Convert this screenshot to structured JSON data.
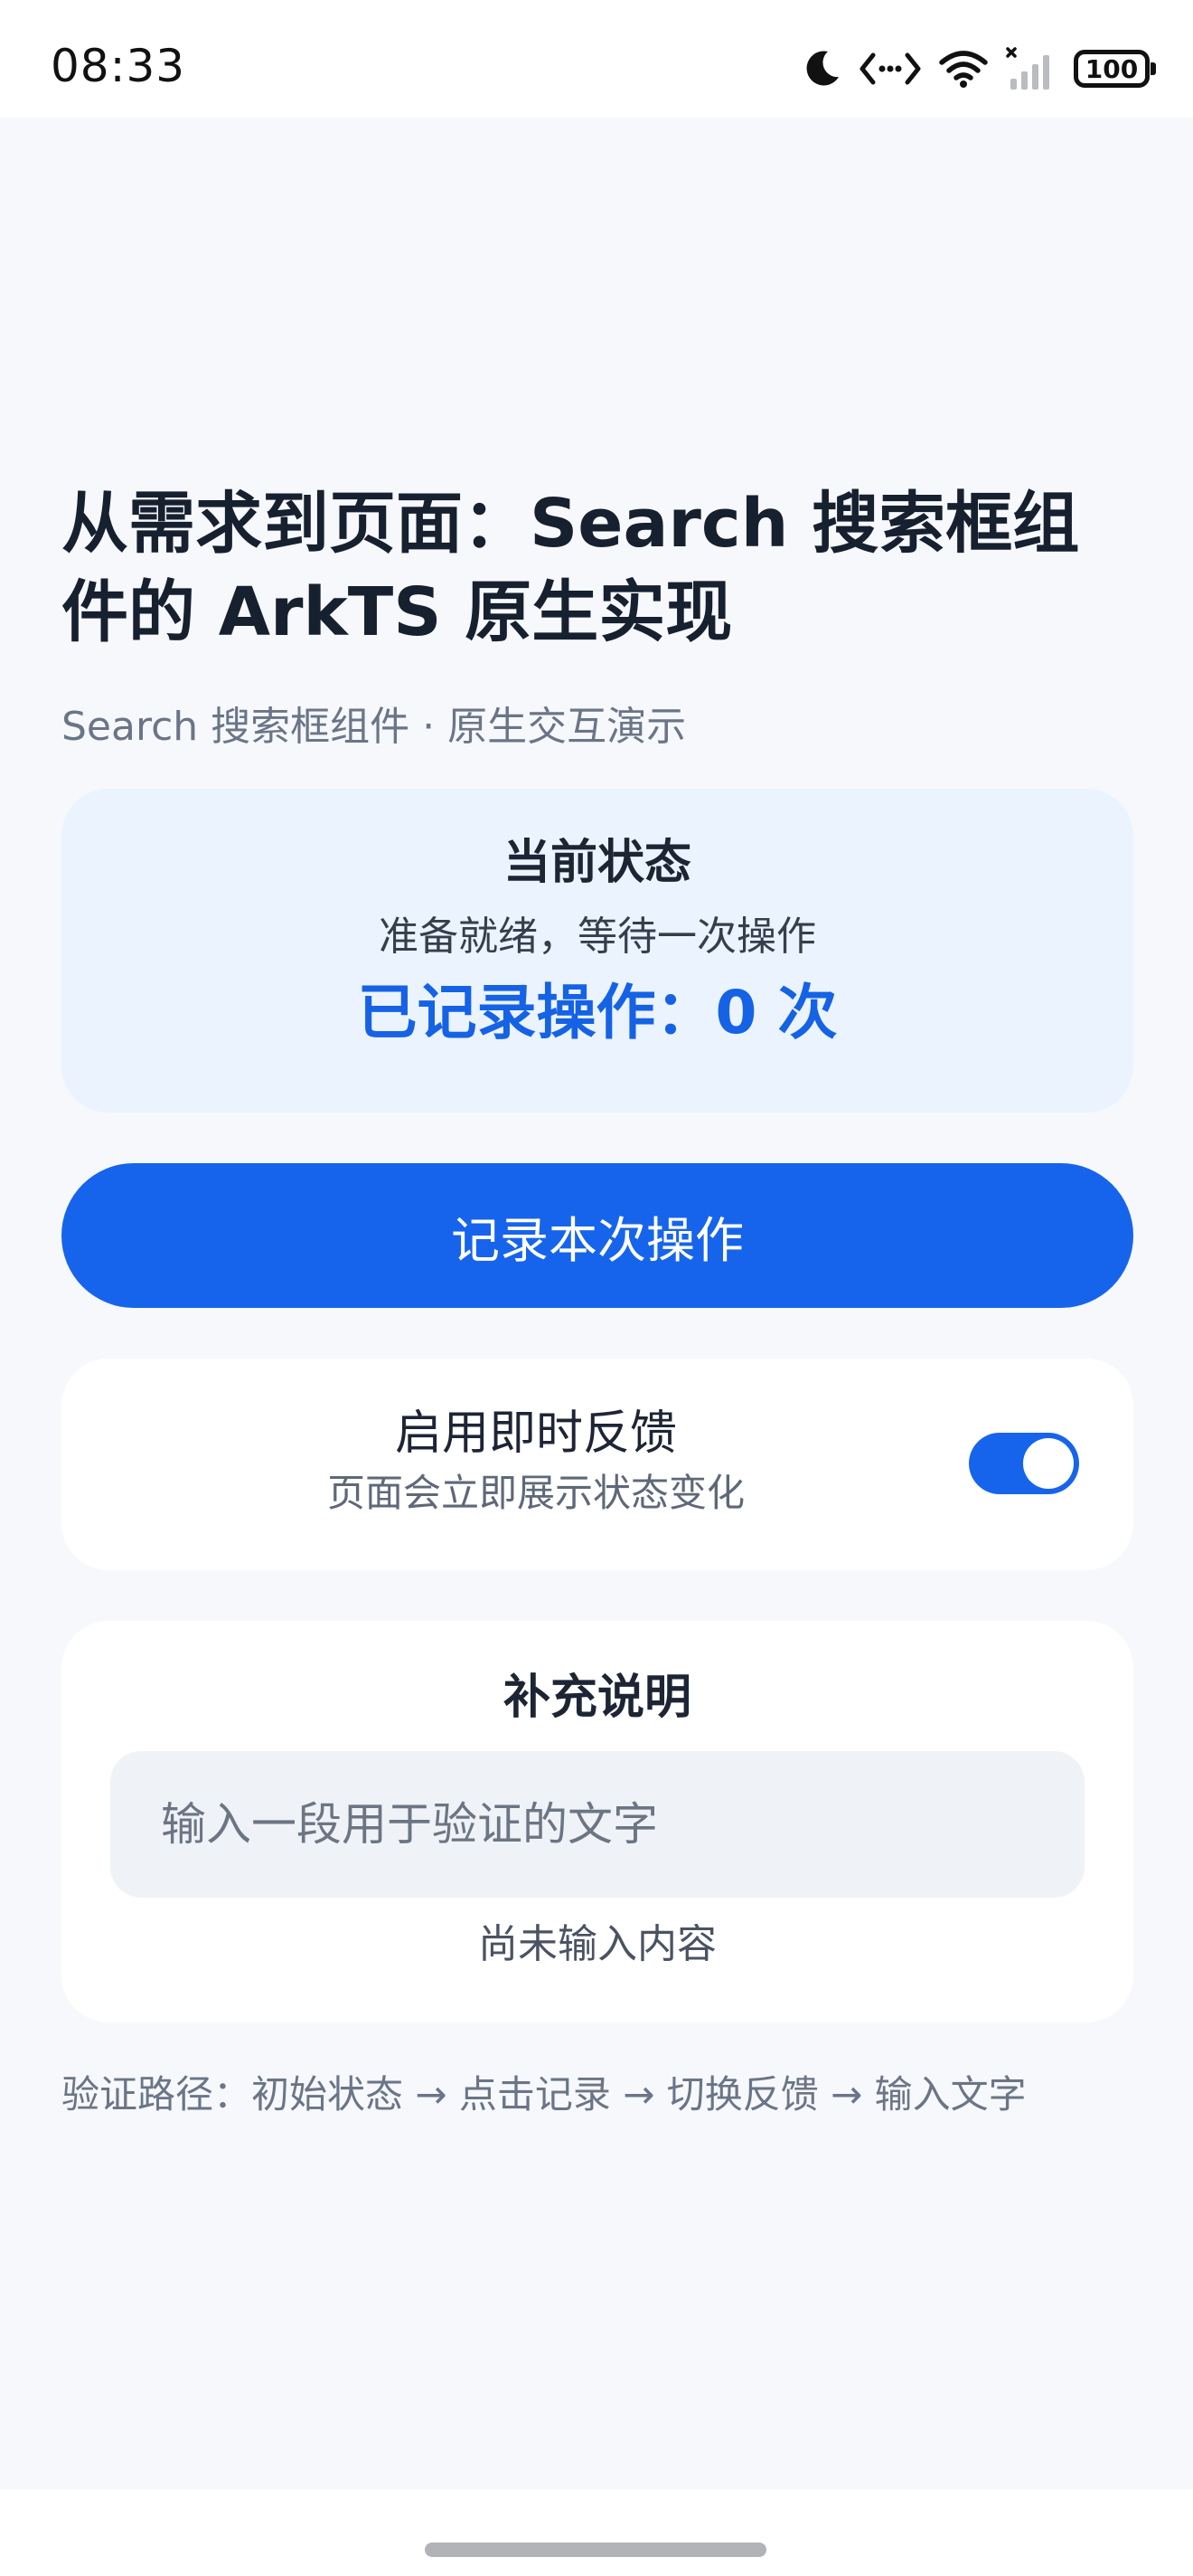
{
  "status_bar": {
    "time": "08:33",
    "battery": "100",
    "icons": [
      "moon-icon",
      "code-arrows-icon",
      "wifi-icon",
      "signal-icon",
      "battery-icon"
    ]
  },
  "page": {
    "title": "从需求到页面：Search 搜索框组件的 ArkTS 原生实现",
    "subtitle": "Search 搜索框组件 · 原生交互演示"
  },
  "status_card": {
    "title": "当前状态",
    "text": "准备就绪，等待一次操作",
    "count_text": "已记录操作：0 次"
  },
  "primary_button": {
    "label": "记录本次操作"
  },
  "toggle_card": {
    "title": "启用即时反馈",
    "description": "页面会立即展示状态变化",
    "enabled": true
  },
  "note_card": {
    "title": "补充说明",
    "input_value": "",
    "input_placeholder": "输入一段用于验证的文字",
    "hint": "尚未输入内容"
  },
  "verify_path": "验证路径：初始状态 → 点击记录 → 切换反馈 → 输入文字",
  "colors": {
    "accent": "#1764ec",
    "background": "#f6f8fb",
    "status_card_bg": "#ebf3fe"
  }
}
